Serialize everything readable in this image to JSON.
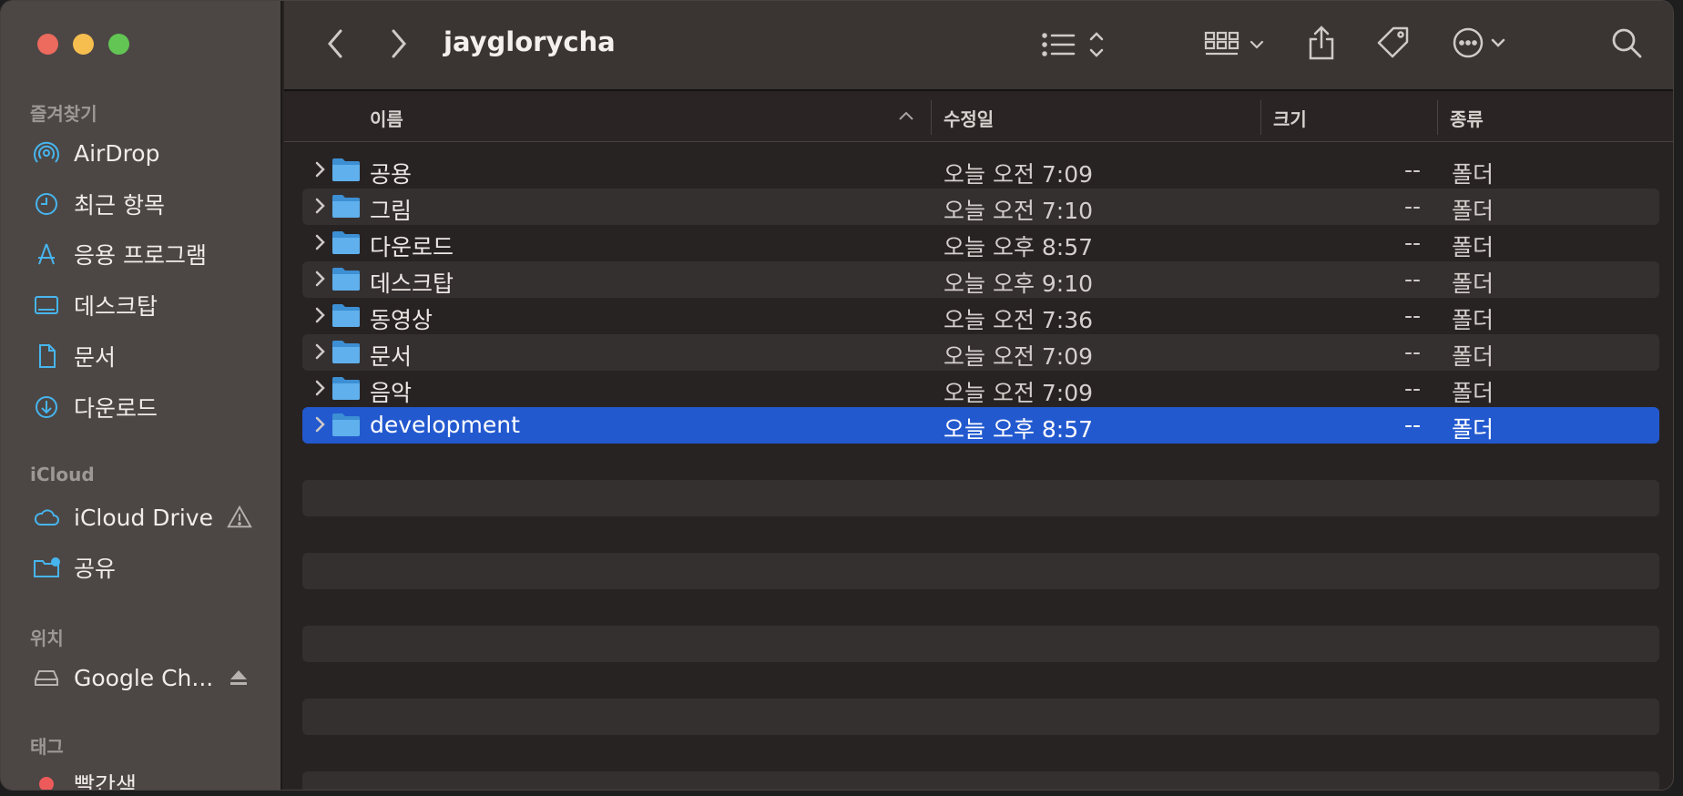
{
  "window": {
    "title": "jayglorycha"
  },
  "sidebar": {
    "favorites_label": "즐겨찾기",
    "favorites": [
      {
        "label": "AirDrop",
        "icon": "airdrop-icon"
      },
      {
        "label": "최근 항목",
        "icon": "clock-icon"
      },
      {
        "label": "응용 프로그램",
        "icon": "applications-icon"
      },
      {
        "label": "데스크탑",
        "icon": "desktop-icon"
      },
      {
        "label": "문서",
        "icon": "document-icon"
      },
      {
        "label": "다운로드",
        "icon": "download-icon"
      }
    ],
    "icloud_label": "iCloud",
    "icloud": [
      {
        "label": "iCloud Drive",
        "icon": "cloud-icon"
      },
      {
        "label": "공유",
        "icon": "shared-folder-icon"
      }
    ],
    "locations_label": "위치",
    "locations": [
      {
        "label": "Google Ch...",
        "icon": "drive-icon"
      }
    ],
    "tags_label": "태그",
    "tags": [
      {
        "label": "빨간색",
        "color": "#ed5a5a"
      }
    ]
  },
  "columns": {
    "name": "이름",
    "modified": "수정일",
    "size": "크기",
    "kind": "종류"
  },
  "files": [
    {
      "name": "공용",
      "date": "오늘 오전 7:09",
      "size": "--",
      "kind": "폴더"
    },
    {
      "name": "그림",
      "date": "오늘 오전 7:10",
      "size": "--",
      "kind": "폴더"
    },
    {
      "name": "다운로드",
      "date": "오늘 오후 8:57",
      "size": "--",
      "kind": "폴더"
    },
    {
      "name": "데스크탑",
      "date": "오늘 오후 9:10",
      "size": "--",
      "kind": "폴더"
    },
    {
      "name": "동영상",
      "date": "오늘 오전 7:36",
      "size": "--",
      "kind": "폴더"
    },
    {
      "name": "문서",
      "date": "오늘 오전 7:09",
      "size": "--",
      "kind": "폴더"
    },
    {
      "name": "음악",
      "date": "오늘 오전 7:09",
      "size": "--",
      "kind": "폴더"
    },
    {
      "name": "development",
      "date": "오늘 오후 8:57",
      "size": "--",
      "kind": "폴더",
      "selected": true
    }
  ],
  "colors": {
    "accent": "#2359cf",
    "folder": "#5fb0ec",
    "sidebar_icon": "#47b5ee"
  }
}
